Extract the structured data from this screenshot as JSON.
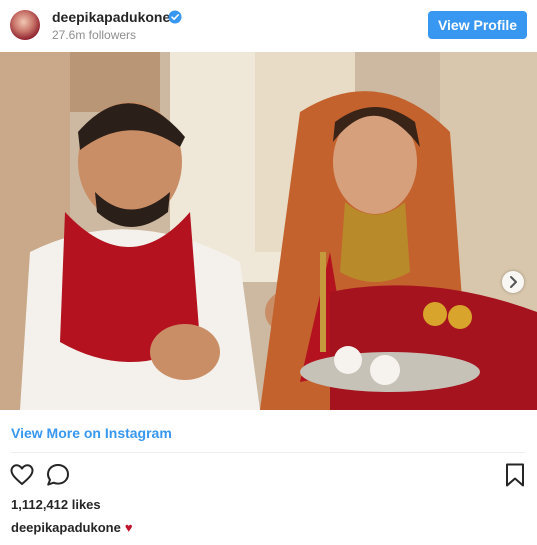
{
  "header": {
    "username": "deepikapadukone",
    "followers": "27.6m followers",
    "view_profile_label": "View Profile",
    "verified_icon": "verified-badge-icon"
  },
  "photo": {
    "next_icon": "chevron-right-icon"
  },
  "footer": {
    "view_more_label": "View More on Instagram",
    "likes": "1,112,412 likes",
    "caption_user": "deepikapadukone",
    "caption_emoji": "♥",
    "icons": [
      "heart-icon",
      "comment-icon",
      "bookmark-icon"
    ]
  },
  "colors": {
    "accent": "#3897f0",
    "text": "#262626",
    "muted": "#8e8e8e",
    "caption_heart": "#c0142c"
  }
}
